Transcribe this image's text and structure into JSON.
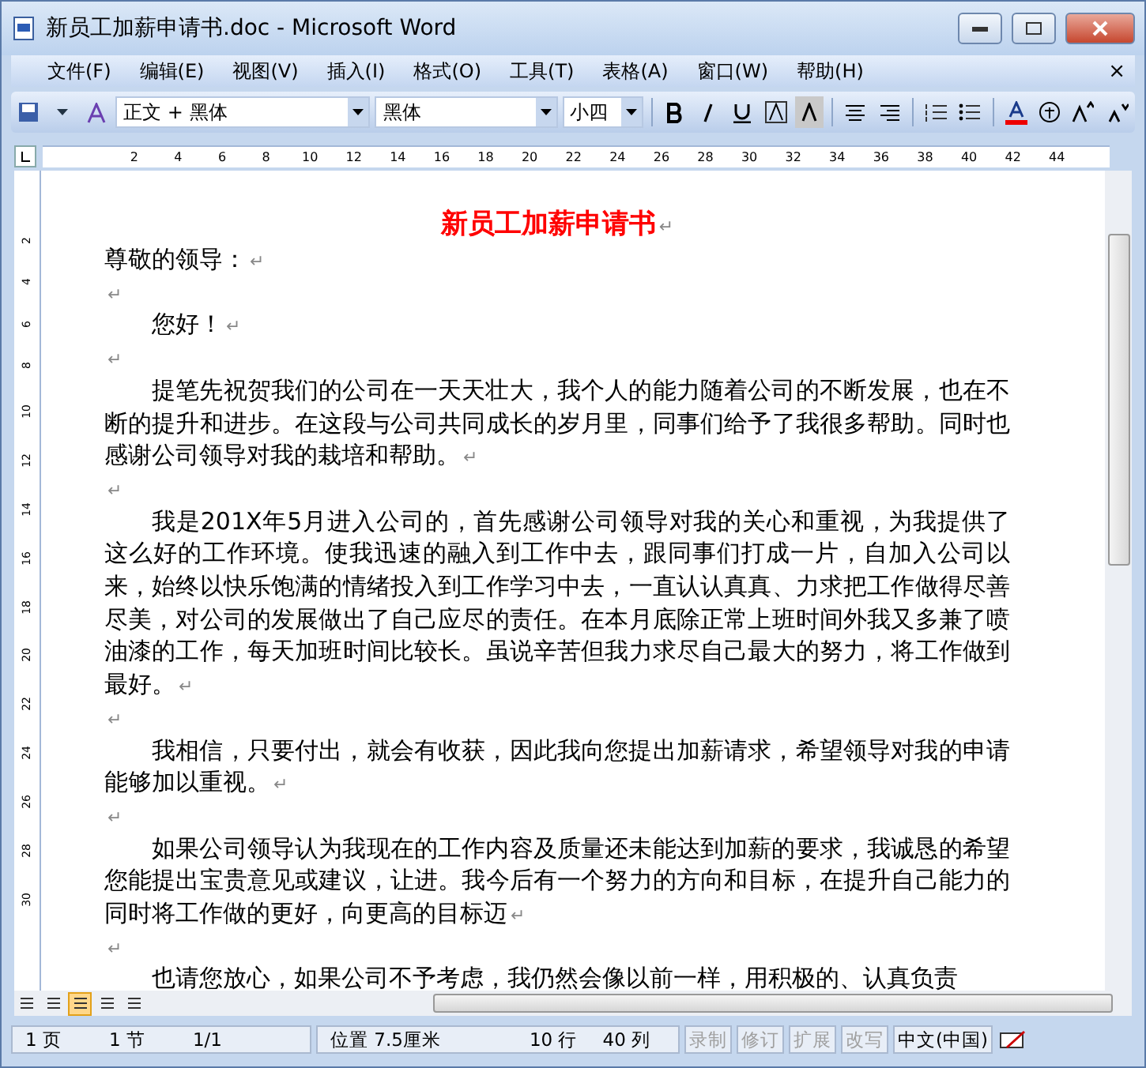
{
  "window": {
    "title": "新员工加薪申请书.doc - Microsoft Word"
  },
  "menu": [
    "文件(F)",
    "编辑(E)",
    "视图(V)",
    "插入(I)",
    "格式(O)",
    "工具(T)",
    "表格(A)",
    "窗口(W)",
    "帮助(H)"
  ],
  "menu_close": "×",
  "toolbar": {
    "style": "正文 + 黑体",
    "font": "黑体",
    "size": "小四"
  },
  "ruler": {
    "ticks": [
      "2",
      "4",
      "6",
      "8",
      "10",
      "12",
      "14",
      "16",
      "18",
      "20",
      "22",
      "24",
      "26",
      "28",
      "30",
      "32",
      "34",
      "36",
      "38",
      "40",
      "42",
      "44"
    ]
  },
  "vruler": {
    "ticks": [
      "2",
      "4",
      "6",
      "8",
      "10",
      "12",
      "14",
      "16",
      "18",
      "20",
      "22",
      "24",
      "26",
      "28",
      "30"
    ]
  },
  "document": {
    "title": "新员工加薪申请书",
    "title_mark": "↵",
    "paragraphs": [
      {
        "text": "尊敬的领导：",
        "mark": "↵",
        "indent": false
      },
      {
        "mark": "↵",
        "indent": false
      },
      {
        "text": "您好！",
        "mark": "↵",
        "indent": true
      },
      {
        "mark": "↵",
        "indent": false
      },
      {
        "text": "提笔先祝贺我们的公司在一天天壮大，我个人的能力随着公司的不断发展，也在不断的提升和进步。在这段与公司共同成长的岁月里，同事们给予了我很多帮助。同时也感谢公司领导对我的栽培和帮助。",
        "mark": "↵",
        "indent": true
      },
      {
        "mark": "↵",
        "indent": false
      },
      {
        "text": "我是201X年5月进入公司的，首先感谢公司领导对我的关心和重视，为我提供了这么好的工作环境。使我迅速的融入到工作中去，跟同事们打成一片，自加入公司以来，始终以快乐饱满的情绪投入到工作学习中去，一直认认真真、力求把工作做得尽善尽美，对公司的发展做出了自己应尽的责任。在本月底除正常上班时间外我又多兼了喷油漆的工作，每天加班时间比较长。虽说辛苦但我力求尽自己最大的努力，将工作做到最好。",
        "mark": "↵",
        "indent": true
      },
      {
        "mark": "↵",
        "indent": false
      },
      {
        "text": "我相信，只要付出，就会有收获，因此我向您提出加薪请求，希望领导对我的申请能够加以重视。",
        "mark": "↵",
        "indent": true
      },
      {
        "mark": "↵",
        "indent": false
      },
      {
        "text": "如果公司领导认为我现在的工作内容及质量还未能达到加薪的要求，我诚恳的希望您能提出宝贵意见或建议，让进。我今后有一个努力的方向和目标，在提升自己能力的同时将工作做的更好，向更高的目标迈",
        "mark": "↵",
        "indent": true
      },
      {
        "mark": "↵",
        "indent": false
      },
      {
        "text": "也请您放心，如果公司不予考虑，我仍然会像以前一样，用积极的、认真负责",
        "indent": true
      }
    ]
  },
  "views": [
    {
      "selected": false
    },
    {
      "selected": false
    },
    {
      "selected": true
    },
    {
      "selected": false
    },
    {
      "selected": false
    }
  ],
  "status_bar": {
    "page": "1 页",
    "section": "1 节",
    "pages": "1/1",
    "position": "位置 7.5厘米",
    "line": "10 行",
    "column": "40 列",
    "modes": [
      {
        "label": "录制",
        "on": false
      },
      {
        "label": "修订",
        "on": false
      },
      {
        "label": "扩展",
        "on": false
      },
      {
        "label": "改写",
        "on": false
      }
    ],
    "language": "中文(中国)"
  }
}
